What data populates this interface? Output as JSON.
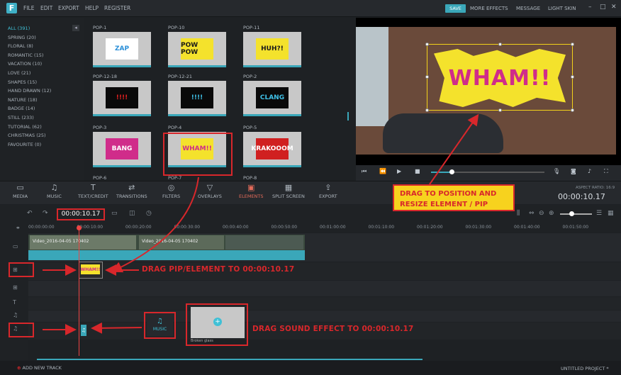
{
  "menu": {
    "logo": "F",
    "items": [
      "FILE",
      "EDIT",
      "EXPORT",
      "HELP",
      "REGISTER"
    ],
    "save": "SAVE",
    "right": [
      "MORE EFFECTS",
      "MESSAGE",
      "LIGHT SKIN"
    ],
    "window_controls": [
      "–",
      "□",
      "✕"
    ]
  },
  "categories": [
    "ALL (391)",
    "SPRING (20)",
    "FLORAL (8)",
    "ROMANTIC (15)",
    "VACATION (10)",
    "LOVE (21)",
    "SHAPES (15)",
    "HAND DRAWN (12)",
    "NATURE (18)",
    "BADGE (14)",
    "STILL (233)",
    "TUTORIAL (62)",
    "CHRISTMAS (25)",
    "FAVOURITE (0)"
  ],
  "elements": [
    {
      "label": "POP-1",
      "art": "ZAP",
      "fg": "#2a8fd8",
      "bg": "#fff"
    },
    {
      "label": "POP-10",
      "art": "POW POW",
      "fg": "#1a1a1a",
      "bg": "#f4e22c"
    },
    {
      "label": "POP-11",
      "art": "HUH?!",
      "fg": "#1a1a1a",
      "bg": "#f4e22c"
    },
    {
      "label": "POP-12-18",
      "art": "!!!!",
      "fg": "#e02020",
      "bg": "#0a0a0a"
    },
    {
      "label": "POP-12-21",
      "art": "!!!!",
      "fg": "#3fc0e6",
      "bg": "#0a0a0a"
    },
    {
      "label": "POP-2",
      "art": "CLANG",
      "fg": "#3fc0e6",
      "bg": "#0a0a0a"
    },
    {
      "label": "POP-3",
      "art": "BANG",
      "fg": "#fff",
      "bg": "#d02c8a"
    },
    {
      "label": "POP-4",
      "art": "WHAM!!",
      "fg": "#d02c8a",
      "bg": "#f4e22c"
    },
    {
      "label": "POP-5",
      "art": "KRAKOOOM",
      "fg": "#fff",
      "bg": "#d02020"
    }
  ],
  "elements_row4": [
    "POP-6",
    "POP-7",
    "POP-8"
  ],
  "preview": {
    "sticker_text": "WHAM!!"
  },
  "toolbar": [
    {
      "label": "MEDIA",
      "icon": "▭"
    },
    {
      "label": "MUSIC",
      "icon": "♫"
    },
    {
      "label": "TEXT/CREDIT",
      "icon": "T"
    },
    {
      "label": "TRANSITIONS",
      "icon": "⇄"
    },
    {
      "label": "FILTERS",
      "icon": "◎"
    },
    {
      "label": "OVERLAYS",
      "icon": "▽"
    },
    {
      "label": "ELEMENTS",
      "icon": "▣"
    },
    {
      "label": "SPLIT SCREEN",
      "icon": "▦"
    },
    {
      "label": "EXPORT",
      "icon": "⇪"
    }
  ],
  "aspect_ratio": "ASPECT RATIO: 16:9",
  "current_time": "00:00:10.17",
  "timeline": {
    "playhead_time": "00:00:10.17",
    "ruler": [
      "00:00:00:00",
      "00:00:10:00",
      "00:00:20:00",
      "00:00:30:00",
      "00:00:40:00",
      "00:00:50:00",
      "00:01:00:00",
      "00:01:10:00",
      "00:01:20:00",
      "00:01:30:00",
      "00:01:40:00",
      "00:01:50:00"
    ],
    "clip1_label": "Video_2016-04-05 170402",
    "clip2_label": "Video_2016-04-05 170402",
    "pip_art": "WHAM!!",
    "sound_icon": "♫"
  },
  "annotations": {
    "callout": "DRAG TO POSITION AND RESIZE ELEMENT / PIP",
    "pip": "DRAG PIP/ELEMENT TO 00:00:10.17",
    "sound": "DRAG SOUND EFFECT TO 00:00:10.17"
  },
  "music_panel": {
    "label": "MUSIC",
    "icon": "♫"
  },
  "sound_item": {
    "label": "Broken glass",
    "plus": "+"
  },
  "status": {
    "add_track": "ADD NEW TRACK",
    "project": "UNTITLED PROJECT *"
  }
}
